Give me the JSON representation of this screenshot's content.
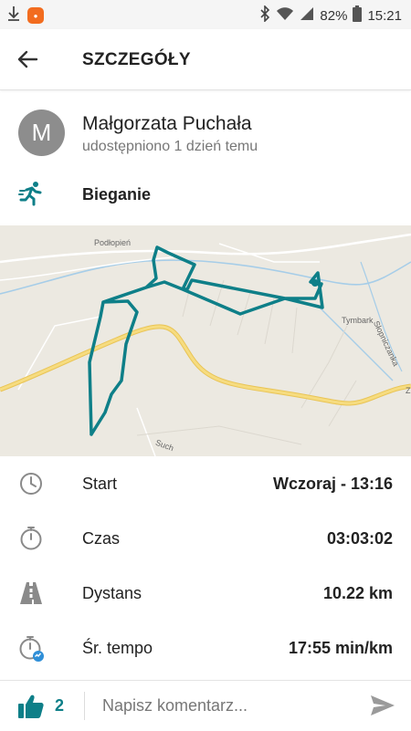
{
  "status_bar": {
    "battery": "82%",
    "time": "15:21",
    "icons": [
      "download-icon",
      "app-notification-icon",
      "bluetooth-icon",
      "wifi-icon",
      "signal-icon",
      "battery-icon"
    ]
  },
  "app_bar": {
    "title": "SZCZEGÓŁY",
    "back_icon": "arrow-left-icon"
  },
  "user": {
    "avatar_letter": "M",
    "name": "Małgorzata Puchała",
    "shared": "udostępniono 1 dzień temu"
  },
  "activity": {
    "icon": "running-icon",
    "label": "Bieganie"
  },
  "map": {
    "labels": {
      "village": "Podłopień",
      "town": "Tymbark",
      "river": "Słopniczanka",
      "road": "Such",
      "edge": "Z"
    },
    "route_color": "#0e7f88"
  },
  "stats": [
    {
      "icon": "clock-icon",
      "label": "Start",
      "value": "Wczoraj - 13:16"
    },
    {
      "icon": "stopwatch-icon",
      "label": "Czas",
      "value": "03:03:02"
    },
    {
      "icon": "road-icon",
      "label": "Dystans",
      "value": "10.22 km"
    },
    {
      "icon": "pace-icon",
      "label": "Śr. tempo",
      "value": "17:55 min/km"
    }
  ],
  "bottom": {
    "likes": "2",
    "comment_placeholder": "Napisz komentarz...",
    "like_icon": "thumbs-up-icon",
    "send_icon": "send-icon"
  },
  "colors": {
    "accent": "#0e7f88",
    "icon_gray": "#8a8a8a",
    "map_bg": "#ece9e1",
    "road_yellow": "#f3d46b"
  }
}
